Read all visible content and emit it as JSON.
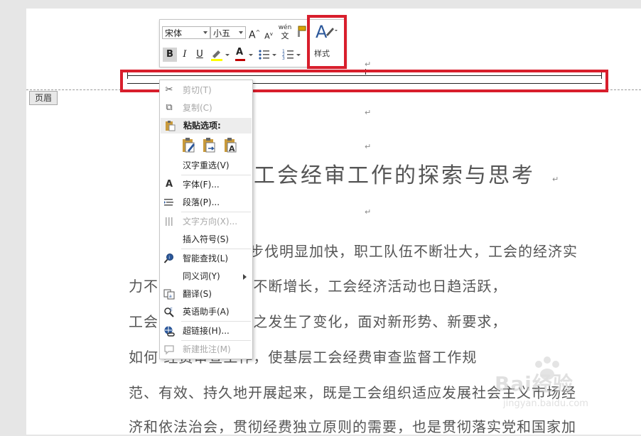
{
  "toolbar": {
    "font_name": "宋体",
    "font_size": "小五",
    "grow_font": "A",
    "shrink_font": "A",
    "phonetic_top": "wén",
    "phonetic_bottom": "文",
    "bold": "B",
    "italic": "I",
    "underline": "U",
    "font_color_glyph": "A",
    "styles_label": "样式"
  },
  "document": {
    "header_tag": "页眉",
    "para_mark": "↵",
    "title": "工会经审工作的探索与思考",
    "lines": [
      "步伐明显加快，职工队伍不断壮大，工会的经济实",
      "力不        经费收支规模不断增长，工会经济活动也日趋活跃，",
      "工会        式和方法也随之发生了变化，面对新形势、新要求，",
      "如何        经费审查工作，使基层工会经费审查监督工作规",
      "范、有效、持久地开展起来，既是工会组织适应发展社会主义市场经",
      "济和依法治会，贯彻经费独立原则的需要，也是贯彻落实党和国家加"
    ]
  },
  "context_menu": {
    "cut": "剪切(T)",
    "copy": "复制(C)",
    "paste_options": "粘贴选项:",
    "reconvert": "汉字重选(V)",
    "font": "字体(F)...",
    "paragraph": "段落(P)...",
    "text_direction": "文字方向(X)...",
    "insert_symbol": "插入符号(S)",
    "smart_lookup": "智能查找(L)",
    "synonyms": "同义词(Y)",
    "translate": "翻译(S)",
    "english_assistant": "英语助手(A)",
    "hyperlink": "超链接(H)...",
    "new_comment": "新建批注(M)"
  },
  "watermark": {
    "brand": "Bai经验",
    "url": "jingyan.baidu.com"
  },
  "colors": {
    "highlight_box": "#d81e2c",
    "accent_blue": "#2b579a",
    "font_color_red": "#c00000",
    "highlight_yellow": "#ffff00"
  }
}
